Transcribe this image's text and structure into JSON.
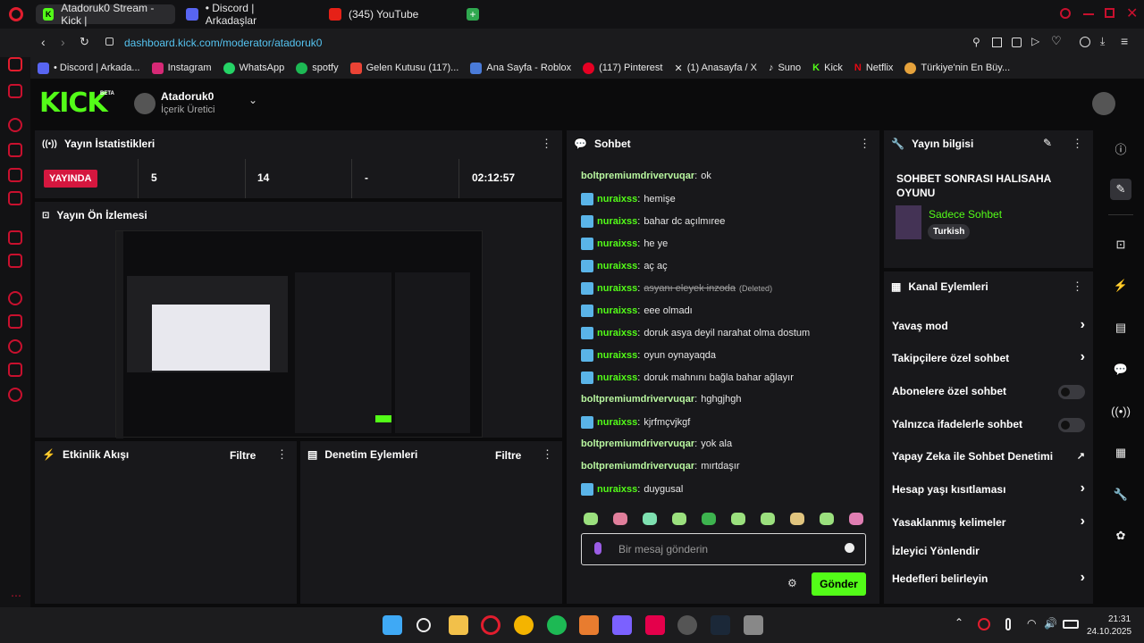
{
  "browser": {
    "tabs": [
      {
        "label": "Atadoruk0 Stream - Kick |"
      },
      {
        "label": "• Discord | Arkadaşlar"
      },
      {
        "label": "(345) YouTube"
      }
    ],
    "url": "dashboard.kick.com/moderator/atadoruk0",
    "bookmarks": [
      "• Discord | Arkada...",
      "Instagram",
      "WhatsApp",
      "spotfy",
      "Gelen Kutusu (117)...",
      "Ana Sayfa - Roblox",
      "(117) Pinterest",
      "(1) Anasayfa / X",
      "Suno",
      "Kick",
      "Netflix",
      "Türkiye'nin En Büy..."
    ]
  },
  "header": {
    "logo": "KICK",
    "beta": "BETA",
    "channel_name": "Atadoruk0",
    "channel_role": "İçerik Üretici"
  },
  "stats": {
    "title": "Yayın İstatistikleri",
    "live_label": "YAYINDA",
    "values": [
      "5",
      "14",
      "-",
      "02:12:57"
    ]
  },
  "preview": {
    "title": "Yayın Ön İzlemesi"
  },
  "activity": {
    "title": "Etkinlik Akışı",
    "filter": "Filtre"
  },
  "moderation": {
    "title": "Denetim Eylemleri",
    "filter": "Filtre"
  },
  "chat": {
    "title": "Sohbet",
    "messages": [
      {
        "user": "boltpremiumdrivervuqar",
        "text": "ok",
        "badge": false
      },
      {
        "user": "nuraixss",
        "text": "hemişe",
        "badge": true
      },
      {
        "user": "nuraixss",
        "text": "bahar dc açılmıree",
        "badge": true
      },
      {
        "user": "nuraixss",
        "text": "he ye",
        "badge": true
      },
      {
        "user": "nuraixss",
        "text": "aç aç",
        "badge": true
      },
      {
        "user": "nuraixss",
        "text": "asyanı eleyek inzoda",
        "deleted": "(Deleted)",
        "badge": true
      },
      {
        "user": "nuraixss",
        "text": "eee olmadı",
        "badge": true
      },
      {
        "user": "nuraixss",
        "text": "doruk asya deyil narahat olma dostum",
        "badge": true
      },
      {
        "user": "nuraixss",
        "text": "oyun oynayaqda",
        "badge": true
      },
      {
        "user": "nuraixss",
        "text": "doruk mahnını bağla bahar ağlayır",
        "badge": true
      },
      {
        "user": "boltpremiumdrivervuqar",
        "text": "hghgjhgh",
        "badge": false
      },
      {
        "user": "nuraixss",
        "text": "kjrfmçvjkgf",
        "badge": true
      },
      {
        "user": "boltpremiumdrivervuqar",
        "text": "yok ala",
        "badge": false
      },
      {
        "user": "boltpremiumdrivervuqar",
        "text": "mırtdaşır",
        "badge": false
      },
      {
        "user": "nuraixss",
        "text": "duygusal",
        "badge": true
      }
    ],
    "placeholder": "Bir mesaj gönderin",
    "send": "Gönder"
  },
  "stream_info": {
    "title": "Yayın bilgisi",
    "stream_title": "SOHBET SONRASI HALISAHA OYUNU",
    "category": "Sadece Sohbet",
    "language": "Turkish"
  },
  "channel_actions": {
    "title": "Kanal Eylemleri",
    "items": [
      {
        "label": "Yavaş mod",
        "type": "chevron"
      },
      {
        "label": "Takipçilere özel sohbet",
        "type": "chevron"
      },
      {
        "label": "Abonelere özel sohbet",
        "type": "toggle"
      },
      {
        "label": "Yalnızca ifadelerle sohbet",
        "type": "toggle"
      },
      {
        "label": "Yapay Zeka ile Sohbet Denetimi",
        "type": "external"
      },
      {
        "label": "Hesap yaşı kısıtlaması",
        "type": "chevron"
      },
      {
        "label": "Yasaklanmış kelimeler",
        "type": "chevron"
      },
      {
        "label": "İzleyici Yönlendir",
        "type": "none"
      },
      {
        "label": "Hedefleri belirleyin",
        "type": "chevron"
      }
    ]
  },
  "taskbar": {
    "time": "21:31",
    "date": "24.10.2025"
  },
  "colors": {
    "accent": "#53fc18",
    "live": "#d5173f",
    "panel": "#18181b"
  }
}
